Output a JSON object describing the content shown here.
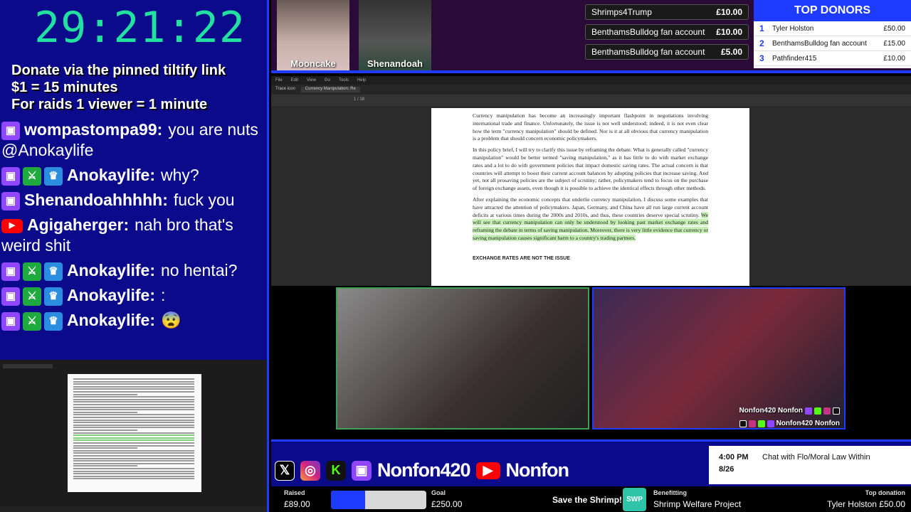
{
  "timer": "29:21:22",
  "info_lines": [
    "Donate via the pinned tiltify link",
    "$1 = 15 minutes",
    "For raids 1 viewer = 1 minute"
  ],
  "chat": [
    {
      "platform": "twitch",
      "badges": [],
      "user": "wompastompa99:",
      "text": "you are nuts @Anokaylife"
    },
    {
      "platform": "twitch",
      "badges": [
        "mod",
        "crown"
      ],
      "user": "Anokaylife:",
      "text": "why?"
    },
    {
      "platform": "twitch",
      "badges": [],
      "user": "Shenandoahhhhh:",
      "text": "fuck you"
    },
    {
      "platform": "youtube",
      "badges": [],
      "user": "Agigaherger:",
      "text": "nah bro that's weird shit"
    },
    {
      "platform": "twitch",
      "badges": [
        "mod",
        "crown"
      ],
      "user": "Anokaylife:",
      "text": "no hentai?"
    },
    {
      "platform": "twitch",
      "badges": [
        "mod",
        "crown"
      ],
      "user": "Anokaylife:",
      "text": ":"
    },
    {
      "platform": "twitch",
      "badges": [
        "mod",
        "crown"
      ],
      "user": "Anokaylife:",
      "text": "😨"
    }
  ],
  "cams": [
    {
      "name": "Mooncake"
    },
    {
      "name": "Shenandoah"
    }
  ],
  "donations": [
    {
      "name": "Shrimps4Trump",
      "amount": "£10.00"
    },
    {
      "name": "BenthamsBulldog fan account",
      "amount": "£10.00"
    },
    {
      "name": "BenthamsBulldog fan account",
      "amount": "£5.00"
    }
  ],
  "top_donors": {
    "title": "TOP DONORS",
    "rows": [
      {
        "rank": "1",
        "name": "Tyler Holston",
        "amount": "£50.00"
      },
      {
        "rank": "2",
        "name": "BenthamsBulldog fan account",
        "amount": "£15.00"
      },
      {
        "rank": "3",
        "name": "Pathfinder415",
        "amount": "£10.00"
      }
    ]
  },
  "pdf": {
    "menu": [
      "File",
      "Edit",
      "View",
      "Go",
      "Tools",
      "Help"
    ],
    "tabs": [
      "Trace icon",
      "Currency Manipulation: Re"
    ],
    "page_indicator": "1 / 18",
    "paragraphs": [
      "Currency manipulation has become an increasingly important flashpoint in negotiations involving international trade and finance. Unfortunately, the issue is not well understood; indeed, it is not even clear how the term \"currency manipulation\" should be defined. Nor is it at all obvious that currency manipulation is a problem that should concern economic policymakers.",
      "In this policy brief, I will try to clarify this issue by reframing the debate. What is generally called \"currency manipulation\" would be better termed \"saving manipulation,\" as it has little to do with market exchange rates and a lot to do with government policies that impact domestic saving rates. The actual concern is that countries will attempt to boost their current account balances by adopting policies that increase saving. And yet, not all prosaving policies are the subject of scrutiny; rather, policymakers tend to focus on the purchase of foreign exchange assets, even though it is possible to achieve the identical effects through other methods."
    ],
    "para3_plain": "After explaining the economic concepts that underlie currency manipulation, I discuss some examples that have attracted the attention of policymakers. Japan, Germany, and China have all run large current account deficits at various times during the 2000s and 2010s, and thus, these countries deserve special scrutiny. ",
    "para3_highlight": "We will see that currency manipulation can only be understood by looking past market exchange rates and reframing the debate in terms of saving manipulation. Moreover, there is very little evidence that currency or saving manipulation causes significant harm to a country's trading partners.",
    "heading": "EXCHANGE RATES ARE NOT THE ISSUE"
  },
  "cam_right_handles": {
    "line1": "Nonfon420 Nonfon",
    "line2": "Nonfon420 Nonfon"
  },
  "bottom": {
    "social_handle_1": "Nonfon420",
    "social_handle_2": "Nonfon",
    "schedule": {
      "time": "4:00 PM",
      "date": "8/26",
      "title": "Chat with Flo/Moral Law Within"
    },
    "raised_label": "Raised",
    "raised_value": "£89.00",
    "goal_label": "Goal",
    "goal_value": "£250.00",
    "progress_fraction": 0.356,
    "cause": "Save the Shrimp!",
    "benefit_label": "Benefitting",
    "benefit_value": "Shrimp Welfare Project",
    "top_label": "Top donation",
    "top_value": "Tyler Holston £50.00",
    "logo_text": "SWP"
  },
  "colors": {
    "accent": "#1e3cff",
    "timer": "#22e0a0",
    "twitch": "#9146ff",
    "youtube": "#ff0000",
    "kick": "#53fc18"
  }
}
